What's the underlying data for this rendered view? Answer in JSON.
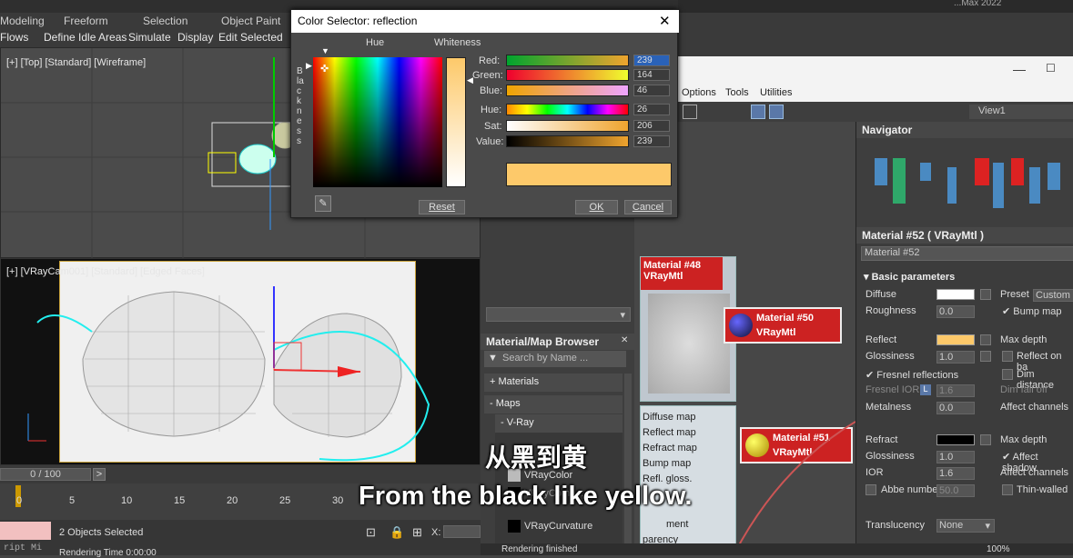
{
  "menubar": {
    "tabs": [
      "Modeling",
      "Freeform",
      "Selection",
      "Object Paint"
    ],
    "subtabs": [
      "Flows",
      "Define Idle Areas",
      "Simulate",
      "Display",
      "Edit Selected"
    ],
    "title_fragment": "...Max 2022"
  },
  "viewport_top": {
    "label": "[+] [Top] [Standard] [Wireframe]"
  },
  "viewport_cam": {
    "label": "[+] [VRayCam001] [Standard] [Edged Faces]"
  },
  "timeline": {
    "frame": "0 / 100",
    "ticks": [
      "0",
      "5",
      "10",
      "15",
      "20",
      "25",
      "30"
    ]
  },
  "status": {
    "selected": "2 Objects Selected",
    "render_time": "Rendering Time 0:00:00",
    "script": "ript Mi",
    "x_label": "X:",
    "render_finished": "Rendering finished",
    "zoom": "100%"
  },
  "color_dialog": {
    "title": "Color Selector: reflection",
    "close": "✕",
    "hue_label": "Hue",
    "whiteness_label": "Whiteness",
    "blackness_label": "Blackness",
    "rows": [
      {
        "label": "Red:",
        "value": "239"
      },
      {
        "label": "Green:",
        "value": "164"
      },
      {
        "label": "Blue:",
        "value": "46"
      },
      {
        "label": "Hue:",
        "value": "26"
      },
      {
        "label": "Sat:",
        "value": "206"
      },
      {
        "label": "Value:",
        "value": "239"
      }
    ],
    "reset": "Reset",
    "ok": "OK",
    "cancel": "Cancel",
    "swatch_color": "#fdc96a"
  },
  "slate": {
    "menu": [
      "Options",
      "Tools",
      "Utilities"
    ],
    "view_tab": "View1",
    "navigator": "Navigator",
    "nodes": [
      {
        "title": "Material #48",
        "type": "VRayMtl"
      },
      {
        "title": "Material #50",
        "type": "VRayMtl"
      },
      {
        "title": "Material #51",
        "type": "VRayMtl"
      }
    ],
    "slots": [
      "Diffuse map",
      "Reflect map",
      "Refract map",
      "Bump map",
      "Refl. gloss."
    ],
    "slots_lower": [
      "ment",
      "parency"
    ]
  },
  "browser": {
    "title": "Material/Map Browser",
    "search": "Search by Name ...",
    "items": [
      "+ Materials",
      "- Maps",
      "- V-Ray"
    ],
    "maps": [
      "VRayColor",
      "VRayComp...",
      "VRayCurvature"
    ]
  },
  "props": {
    "title": "Material #52  ( VRayMtl )",
    "name": "Material #52",
    "section": "Basic parameters",
    "diffuse": "Diffuse",
    "roughness": "Roughness",
    "roughness_val": "0.0",
    "preset": "Preset",
    "preset_val": "Custom",
    "bump": "Bump map",
    "reflect": "Reflect",
    "max_depth": "Max depth",
    "glossiness": "Glossiness",
    "gloss_val": "1.0",
    "reflect_back": "Reflect on ba",
    "fresnel": "Fresnel reflections",
    "dim": "Dim distance",
    "fresnel_ior": "Fresnel IOR",
    "l": "L",
    "fior_val": "1.6",
    "dim_falloff": "Dim fall off",
    "metalness": "Metalness",
    "metal_val": "0.0",
    "affect_ch": "Affect channels",
    "refract": "Refract",
    "max_depth2": "Max depth",
    "glossiness2": "Glossiness",
    "gloss2_val": "1.0",
    "affect_shadow": "Affect shadow",
    "ior": "IOR",
    "ior_val": "1.6",
    "affect_ch2": "Affect channels",
    "abbe": "Abbe number",
    "abbe_val": "50.0",
    "thin": "Thin-walled",
    "translucency": "Translucency",
    "trans_val": "None",
    "reflect_color": "#fdc96a"
  },
  "subtitles": {
    "zh": "从黑到黄",
    "en": "From the black like yellow."
  }
}
